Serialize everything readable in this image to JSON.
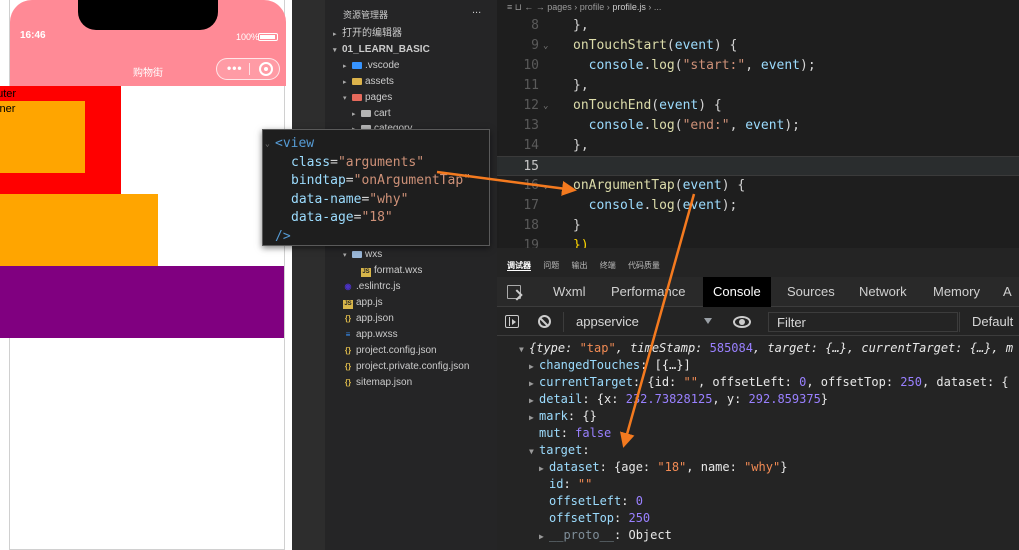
{
  "phone": {
    "time": "16:46",
    "battery": "100%",
    "nav_title": "购物街",
    "capsule_dots": "•••",
    "outer_label": "outer",
    "inner_label": "inner"
  },
  "explorer": {
    "title": "资源管理器",
    "more": "...",
    "open_editors": "打开的编辑器",
    "project": "01_LEARN_BASIC",
    "items": [
      {
        "label": ".vscode"
      },
      {
        "label": "assets"
      },
      {
        "label": "pages"
      },
      {
        "label": "cart"
      },
      {
        "label": "category"
      },
      {
        "label": "wxs"
      },
      {
        "label": "format.wxs"
      },
      {
        "label": ".eslintrc.js"
      },
      {
        "label": "app.js"
      },
      {
        "label": "app.json"
      },
      {
        "label": "app.wxss"
      },
      {
        "label": "project.config.json"
      },
      {
        "label": "project.private.config.json"
      },
      {
        "label": "sitemap.json"
      }
    ]
  },
  "editor": {
    "breadcrumb": {
      "prefix": "≡  ⊔  ←  →   pages › profile › ",
      "file": "profile.js",
      "suffix": " › ..."
    },
    "lines": [
      {
        "n": "8",
        "parts": [
          [
            "tk-punc",
            "},"
          ]
        ]
      },
      {
        "n": "9",
        "fold": "⌄",
        "parts": [
          [
            "tk-fn",
            "onTouchStart"
          ],
          [
            "tk-punc",
            "("
          ],
          [
            "tk-obj",
            "event"
          ],
          [
            "tk-punc",
            ") {"
          ]
        ]
      },
      {
        "n": "10",
        "parts": [
          [
            "tk-punc",
            "  "
          ],
          [
            "tk-obj",
            "console"
          ],
          [
            "tk-punc",
            "."
          ],
          [
            "tk-fn",
            "log"
          ],
          [
            "tk-punc",
            "("
          ],
          [
            "tk-str",
            "\"start:\""
          ],
          [
            "tk-punc",
            ", "
          ],
          [
            "tk-obj",
            "event"
          ],
          [
            "tk-punc",
            ");"
          ]
        ]
      },
      {
        "n": "11",
        "parts": [
          [
            "tk-punc",
            "},"
          ]
        ]
      },
      {
        "n": "12",
        "fold": "⌄",
        "parts": [
          [
            "tk-fn",
            "onTouchEnd"
          ],
          [
            "tk-punc",
            "("
          ],
          [
            "tk-obj",
            "event"
          ],
          [
            "tk-punc",
            ") {"
          ]
        ]
      },
      {
        "n": "13",
        "parts": [
          [
            "tk-punc",
            "  "
          ],
          [
            "tk-obj",
            "console"
          ],
          [
            "tk-punc",
            "."
          ],
          [
            "tk-fn",
            "log"
          ],
          [
            "tk-punc",
            "("
          ],
          [
            "tk-str",
            "\"end:\""
          ],
          [
            "tk-punc",
            ", "
          ],
          [
            "tk-obj",
            "event"
          ],
          [
            "tk-punc",
            ");"
          ]
        ]
      },
      {
        "n": "14",
        "parts": [
          [
            "tk-punc",
            "},"
          ]
        ]
      },
      {
        "n": "15",
        "active": true,
        "parts": []
      },
      {
        "n": "16",
        "fold": "⌄",
        "parts": [
          [
            "tk-fn",
            "onArgumentTap"
          ],
          [
            "tk-punc",
            "("
          ],
          [
            "tk-obj",
            "event"
          ],
          [
            "tk-punc",
            ") {"
          ]
        ]
      },
      {
        "n": "17",
        "parts": [
          [
            "tk-punc",
            "  "
          ],
          [
            "tk-obj",
            "console"
          ],
          [
            "tk-punc",
            "."
          ],
          [
            "tk-fn",
            "log"
          ],
          [
            "tk-punc",
            "("
          ],
          [
            "tk-obj",
            "event"
          ],
          [
            "tk-punc",
            ");"
          ]
        ]
      },
      {
        "n": "18",
        "parts": [
          [
            "tk-punc",
            "}"
          ]
        ]
      },
      {
        "n": "19",
        "parts": [
          [
            "tk-brace",
            "})"
          ]
        ]
      }
    ]
  },
  "devtools": {
    "tabs": [
      "调试器",
      "问题",
      "输出",
      "终端",
      "代码质量"
    ],
    "panel_tabs": [
      "Wxml",
      "Performance",
      "Console",
      "Sources",
      "Network",
      "Memory",
      "A"
    ],
    "context": "appservice",
    "filter_placeholder": "Filter",
    "level": "Default"
  },
  "console": {
    "lines": [
      {
        "indent": 0,
        "tri": "▼",
        "parts": [
          [
            "ci",
            "{type: "
          ],
          [
            "cs",
            "\"tap\""
          ],
          [
            "ci",
            ", timeStamp: "
          ],
          [
            "cn",
            "585084"
          ],
          [
            "ci",
            ", target: {…}, currentTarget: {…}, m"
          ]
        ]
      },
      {
        "indent": 1,
        "tri": "▶",
        "parts": [
          [
            "ck",
            "changedTouches"
          ],
          [
            "cv",
            ": [{…}]"
          ]
        ]
      },
      {
        "indent": 1,
        "tri": "▶",
        "parts": [
          [
            "ck",
            "currentTarget"
          ],
          [
            "cv",
            ": {id: "
          ],
          [
            "cs",
            "\"\""
          ],
          [
            "cv",
            ", offsetLeft: "
          ],
          [
            "cn",
            "0"
          ],
          [
            "cv",
            ", offsetTop: "
          ],
          [
            "cn",
            "250"
          ],
          [
            "cv",
            ", dataset: {"
          ]
        ]
      },
      {
        "indent": 1,
        "tri": "▶",
        "parts": [
          [
            "ck",
            "detail"
          ],
          [
            "cv",
            ": {x: "
          ],
          [
            "cn",
            "232.73828125"
          ],
          [
            "cv",
            ", y: "
          ],
          [
            "cn",
            "292.859375"
          ],
          [
            "cv",
            "}"
          ]
        ]
      },
      {
        "indent": 1,
        "tri": "▶",
        "parts": [
          [
            "ck",
            "mark"
          ],
          [
            "cv",
            ": {}"
          ]
        ]
      },
      {
        "indent": 1,
        "tri": "",
        "parts": [
          [
            "ck",
            "mut"
          ],
          [
            "cv",
            ": "
          ],
          [
            "cb",
            "false"
          ]
        ]
      },
      {
        "indent": 1,
        "tri": "▼",
        "parts": [
          [
            "ck",
            "target"
          ],
          [
            "cv",
            ":"
          ]
        ]
      },
      {
        "indent": 2,
        "tri": "▶",
        "parts": [
          [
            "ck",
            "dataset"
          ],
          [
            "cv",
            ": {age: "
          ],
          [
            "cs",
            "\"18\""
          ],
          [
            "cv",
            ", name: "
          ],
          [
            "cs",
            "\"why\""
          ],
          [
            "cv",
            "}"
          ]
        ]
      },
      {
        "indent": 2,
        "tri": "",
        "parts": [
          [
            "ck",
            "id"
          ],
          [
            "cv",
            ": "
          ],
          [
            "cs",
            "\"\""
          ]
        ]
      },
      {
        "indent": 2,
        "tri": "",
        "parts": [
          [
            "ck",
            "offsetLeft"
          ],
          [
            "cv",
            ": "
          ],
          [
            "cn",
            "0"
          ]
        ]
      },
      {
        "indent": 2,
        "tri": "",
        "parts": [
          [
            "ck",
            "offsetTop"
          ],
          [
            "cv",
            ": "
          ],
          [
            "cn",
            "250"
          ]
        ]
      },
      {
        "indent": 2,
        "tri": "▶",
        "parts": [
          [
            "ck-dim",
            "__proto__"
          ],
          [
            "cv",
            ": Object"
          ]
        ]
      }
    ]
  },
  "popup": {
    "lines": [
      {
        "indent": 0,
        "fold": "⌄",
        "parts": [
          [
            "p-tag",
            "<view"
          ]
        ]
      },
      {
        "indent": 1,
        "parts": [
          [
            "p-attr",
            "class"
          ],
          [
            "p-eq",
            "="
          ],
          [
            "p-str",
            "\"arguments\""
          ]
        ]
      },
      {
        "indent": 1,
        "parts": [
          [
            "p-attr",
            "bindtap"
          ],
          [
            "p-eq",
            "="
          ],
          [
            "p-str",
            "\"onArgumentTap\""
          ]
        ]
      },
      {
        "indent": 1,
        "parts": [
          [
            "p-attr",
            "data-name"
          ],
          [
            "p-eq",
            "="
          ],
          [
            "p-str",
            "\"why\""
          ]
        ]
      },
      {
        "indent": 1,
        "parts": [
          [
            "p-attr",
            "data-age"
          ],
          [
            "p-eq",
            "="
          ],
          [
            "p-str",
            "\"18\""
          ]
        ]
      },
      {
        "indent": 0,
        "parts": [
          [
            "p-tag",
            "/>"
          ]
        ]
      }
    ]
  },
  "colors": {
    "nav_pink": "#ff8a96",
    "outer_red": "#ff0000",
    "inner_orange": "#ffa500",
    "purple": "#800080",
    "arrow_orange": "#f47a1f"
  }
}
